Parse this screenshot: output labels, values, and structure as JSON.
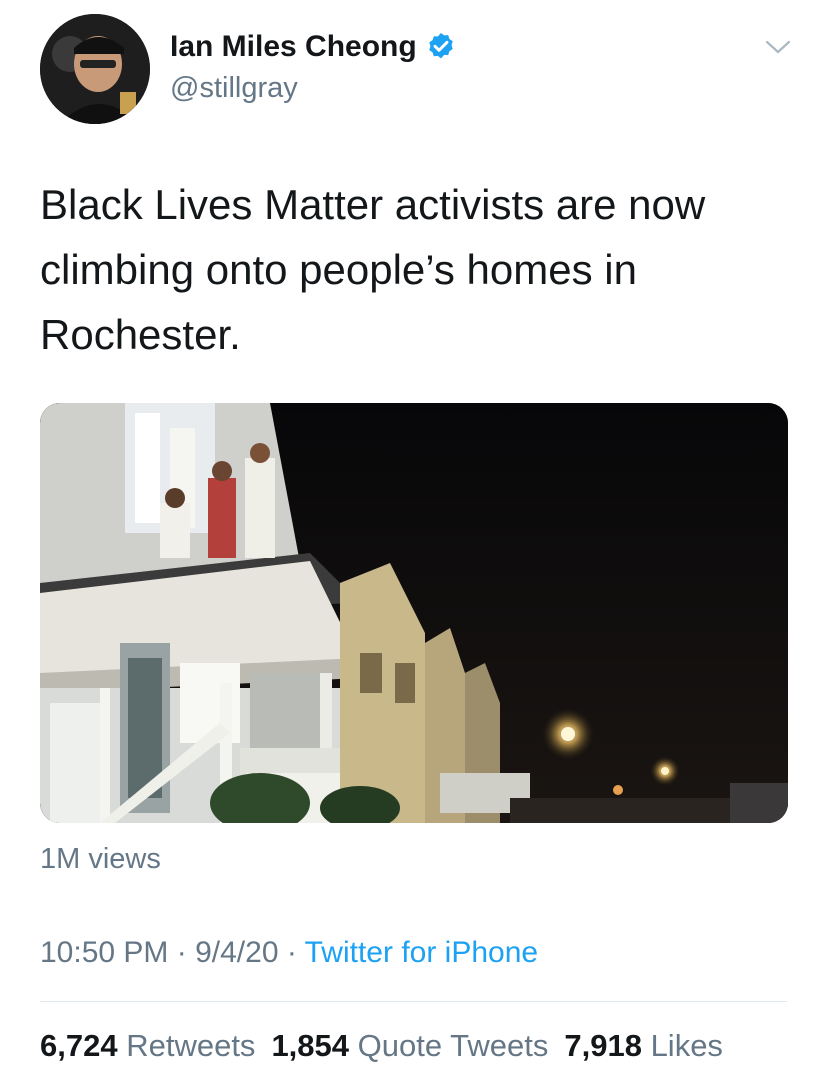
{
  "author": {
    "name": "Ian Miles Cheong",
    "handle": "@stillgray",
    "verified": true,
    "avatar_icon": "user-avatar"
  },
  "menu_icon": "chevron-down-icon",
  "tweet": {
    "text": "Black Lives Matter activists are now climbing onto people’s homes in Rochester."
  },
  "media": {
    "type": "video"
  },
  "views": "1M views",
  "meta": {
    "time": "10:50 PM",
    "date": "9/4/20",
    "separator": " · ",
    "source": "Twitter for iPhone"
  },
  "stats": {
    "retweets_count": "6,724",
    "retweets_label": "Retweets",
    "quotes_count": "1,854",
    "quotes_label": "Quote Tweets",
    "likes_count": "7,918",
    "likes_label": "Likes"
  },
  "colors": {
    "verified_blue": "#1da1f2",
    "secondary_text": "#657786",
    "link_blue": "#1da1f2"
  }
}
